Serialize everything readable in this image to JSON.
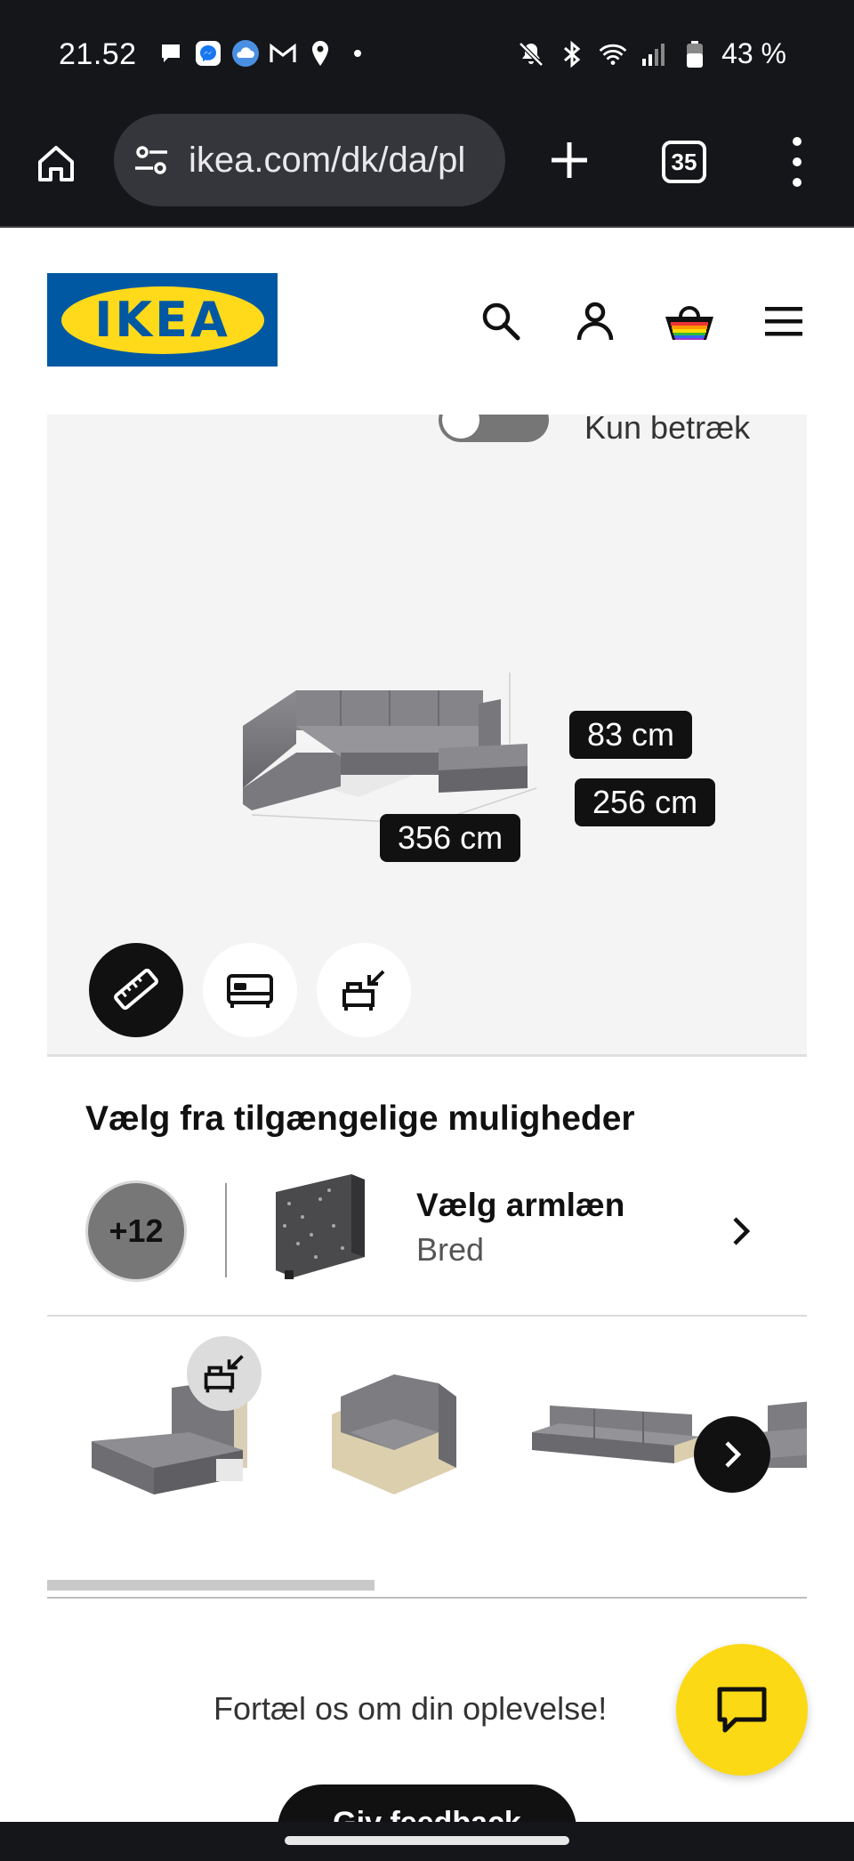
{
  "status_bar": {
    "time": "21.52",
    "battery": "43 %"
  },
  "browser": {
    "url": "ikea.com/dk/da/pl",
    "tab_count": "35"
  },
  "header": {
    "logo_text": "IKEA"
  },
  "viewer": {
    "toggle_label": "Kun betræk",
    "dimensions": {
      "height": "83 cm",
      "depth": "256 cm",
      "width": "356 cm"
    },
    "tools": [
      "ruler-icon",
      "bed-icon",
      "modular-icon"
    ]
  },
  "options": {
    "title": "Vælg fra tilgængelige muligheder",
    "more_count": "+12",
    "armrest_title": "Vælg armlæn",
    "armrest_value": "Bred"
  },
  "feedback": {
    "prompt": "Fortæl os om din oplevelse!",
    "button_label": "Giv feedback"
  },
  "colors": {
    "ikea_blue": "#0058a3",
    "ikea_yellow": "#ffda1a",
    "chat_yellow": "#fbd914"
  }
}
